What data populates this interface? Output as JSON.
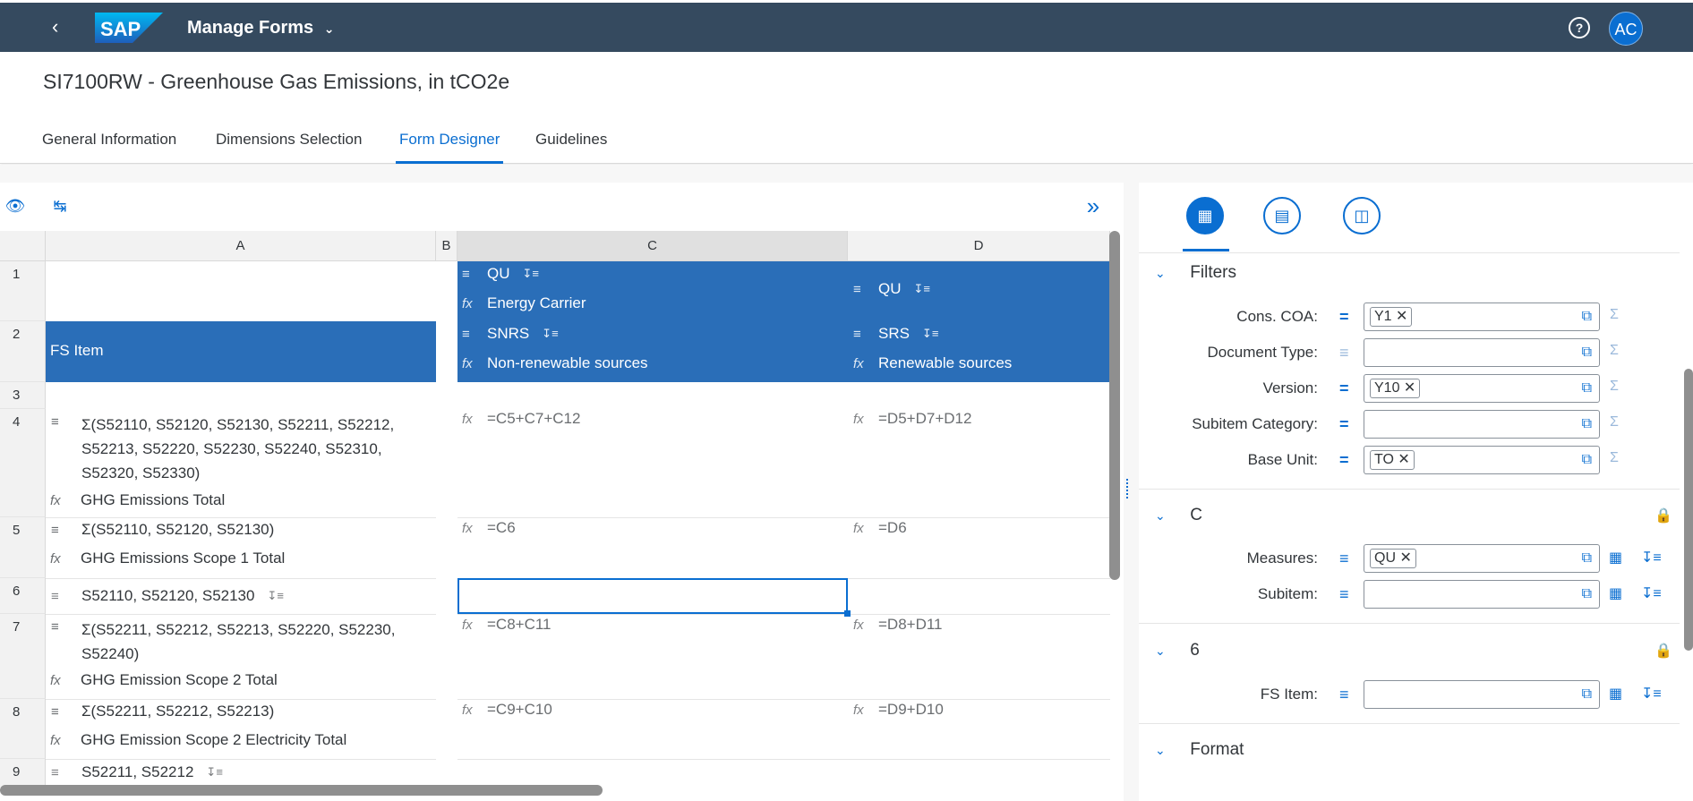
{
  "shell": {
    "logo": "SAP",
    "app_title": "Manage Forms",
    "avatar_initials": "AC",
    "help": "?"
  },
  "page_title": "SI7100RW - Greenhouse Gas Emissions, in tCO2e",
  "tabs": [
    "General Information",
    "Dimensions Selection",
    "Form Designer",
    "Guidelines"
  ],
  "active_tab": "Form Designer",
  "grid": {
    "columns": [
      "A",
      "B",
      "C",
      "D"
    ],
    "rows": [
      "1",
      "2",
      "3",
      "4",
      "5",
      "6",
      "7",
      "8",
      "9"
    ],
    "header_cells": {
      "c1_measure": "QU",
      "c1_label": "Energy Carrier",
      "d1_measure": "QU",
      "a2_label": "FS Item",
      "c2_code": "SNRS",
      "c2_label": "Non-renewable sources",
      "d2_code": "SRS",
      "d2_label": "Renewable sources"
    },
    "r4": {
      "a_formula": "Σ(S52110, S52120, S52130, S52211, S52212, S52213, S52220, S52230, S52240, S52310, S52320, S52330)",
      "a_label": "GHG Emissions Total",
      "c": "=C5+C7+C12",
      "d": "=D5+D7+D12"
    },
    "r5": {
      "a_formula": "Σ(S52110, S52120, S52130)",
      "a_label": "GHG Emissions Scope 1 Total",
      "c": "=C6",
      "d": "=D6"
    },
    "r6": {
      "a_items": "S52110, S52120, S52130"
    },
    "r7": {
      "a_formula": "Σ(S52211, S52212, S52213, S52220, S52230, S52240)",
      "a_label": "GHG Emission Scope 2 Total",
      "c": "=C8+C11",
      "d": "=D8+D11"
    },
    "r8": {
      "a_formula": "Σ(S52211, S52212, S52213)",
      "a_label": "GHG Emission Scope 2 Electricity Total",
      "c": "=C9+C10",
      "d": "=D9+D10"
    },
    "r9": {
      "a_items": "S52211, S52212"
    }
  },
  "panel": {
    "filters": {
      "title": "Filters",
      "fields": [
        {
          "label": "Cons. COA:",
          "token": "Y1"
        },
        {
          "label": "Document Type:",
          "token": ""
        },
        {
          "label": "Version:",
          "token": "Y10"
        },
        {
          "label": "Subitem Category:",
          "token": ""
        },
        {
          "label": "Base Unit:",
          "token": "TO"
        }
      ]
    },
    "c_section": {
      "title": "C",
      "fields": [
        {
          "label": "Measures:",
          "token": "QU"
        },
        {
          "label": "Subitem:",
          "token": ""
        }
      ]
    },
    "row_section": {
      "title": "6",
      "fields": [
        {
          "label": "FS Item:",
          "token": ""
        }
      ]
    },
    "format": {
      "title": "Format"
    }
  },
  "colors": {
    "shell": "#354a5f",
    "accent": "#0a6ed1",
    "header_cell": "#2a6eb8"
  }
}
